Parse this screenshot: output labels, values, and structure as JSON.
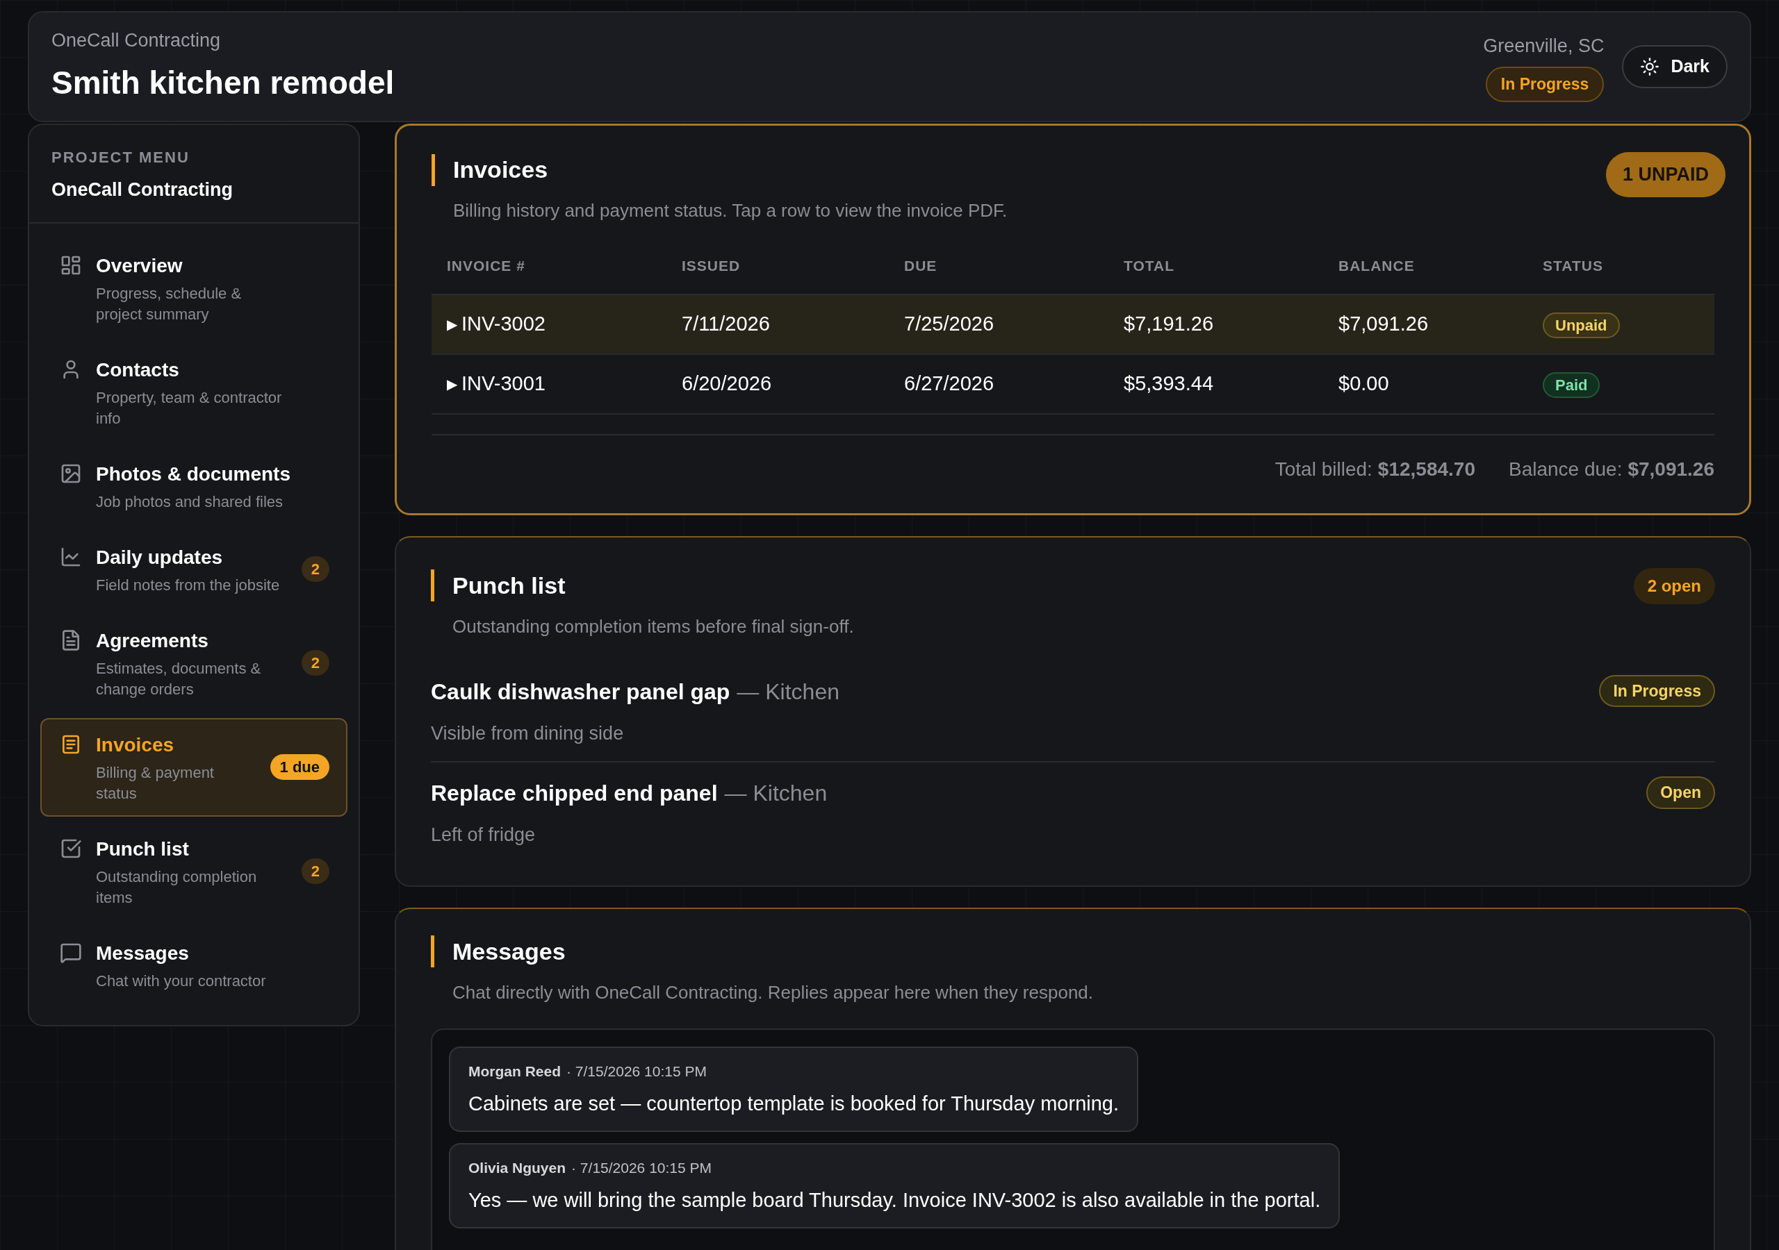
{
  "header": {
    "company": "OneCall Contracting",
    "title": "Smith kitchen remodel",
    "location": "Greenville, SC",
    "status": "In Progress",
    "theme_button": "Dark"
  },
  "sidebar": {
    "heading": "PROJECT MENU",
    "subtitle": "OneCall Contracting",
    "items": [
      {
        "label": "Overview",
        "description": "Progress, schedule & project summary",
        "selected": false
      },
      {
        "label": "Contacts",
        "description": "Property, team & contractor info",
        "selected": false
      },
      {
        "label": "Photos & documents",
        "description": "Job photos and shared files",
        "selected": false
      },
      {
        "label": "Daily updates",
        "description": "Field notes from the jobsite",
        "badge": "2",
        "selected": false
      },
      {
        "label": "Agreements",
        "description": "Estimates, documents & change orders",
        "badge": "2",
        "selected": false
      },
      {
        "label": "Invoices",
        "description": "Billing & payment status",
        "badge": "1 due",
        "selected": true
      },
      {
        "label": "Punch list",
        "description": "Outstanding completion items",
        "badge": "2",
        "selected": false
      },
      {
        "label": "Messages",
        "description": "Chat with your contractor",
        "selected": false
      }
    ]
  },
  "invoices": {
    "highlighted": true,
    "title": "Invoices",
    "subtitle": "Billing history and payment status. Tap a row to view the invoice PDF.",
    "badge": "1 UNPAID",
    "table": {
      "columns": [
        "INVOICE #",
        "ISSUED",
        "DUE",
        "TOTAL",
        "BALANCE",
        "STATUS"
      ],
      "rows": [
        {
          "toggle": "▶",
          "invoice": "INV-3002",
          "issued": "7/11/2026",
          "due": "7/25/2026",
          "total": "$7,191.26",
          "balance": "$7,091.26",
          "status": {
            "label": "Unpaid",
            "kind": "unpaid"
          },
          "selected": true
        },
        {
          "toggle": "▶",
          "invoice": "INV-3001",
          "issued": "6/20/2026",
          "due": "6/27/2026",
          "total": "$5,393.44",
          "balance": "$0.00",
          "status": {
            "label": "Paid",
            "kind": "paid"
          },
          "selected": false
        }
      ]
    },
    "totals": [
      {
        "label": "Total billed:",
        "value": "$12,584.70"
      },
      {
        "label": "Balance due:",
        "value": "$7,091.26"
      }
    ]
  },
  "punch_list": {
    "highlighted": false,
    "title": "Punch list",
    "subtitle": "Outstanding completion items before final sign-off.",
    "badge": "2 open",
    "items": [
      {
        "title": "Caulk dishwasher panel gap",
        "location": "— Kitchen",
        "note": "Visible from dining side",
        "status": "In Progress"
      },
      {
        "title": "Replace chipped end panel",
        "location": "— Kitchen",
        "note": "Left of fridge",
        "status": "Open"
      }
    ]
  },
  "messages": {
    "highlighted": false,
    "title": "Messages",
    "subtitle": "Chat directly with OneCall Contracting. Replies appear here when they respond.",
    "items": [
      {
        "author": "Morgan Reed",
        "time": "· 7/15/2026 10:15 PM",
        "text": "Cabinets are set — countertop template is booked for Thursday morning."
      },
      {
        "author": "Olivia Nguyen",
        "time": "· 7/15/2026 10:15 PM",
        "text": "Yes — we will bring the sample board Thursday. Invoice INV-3002 is also available in the portal."
      }
    ]
  }
}
